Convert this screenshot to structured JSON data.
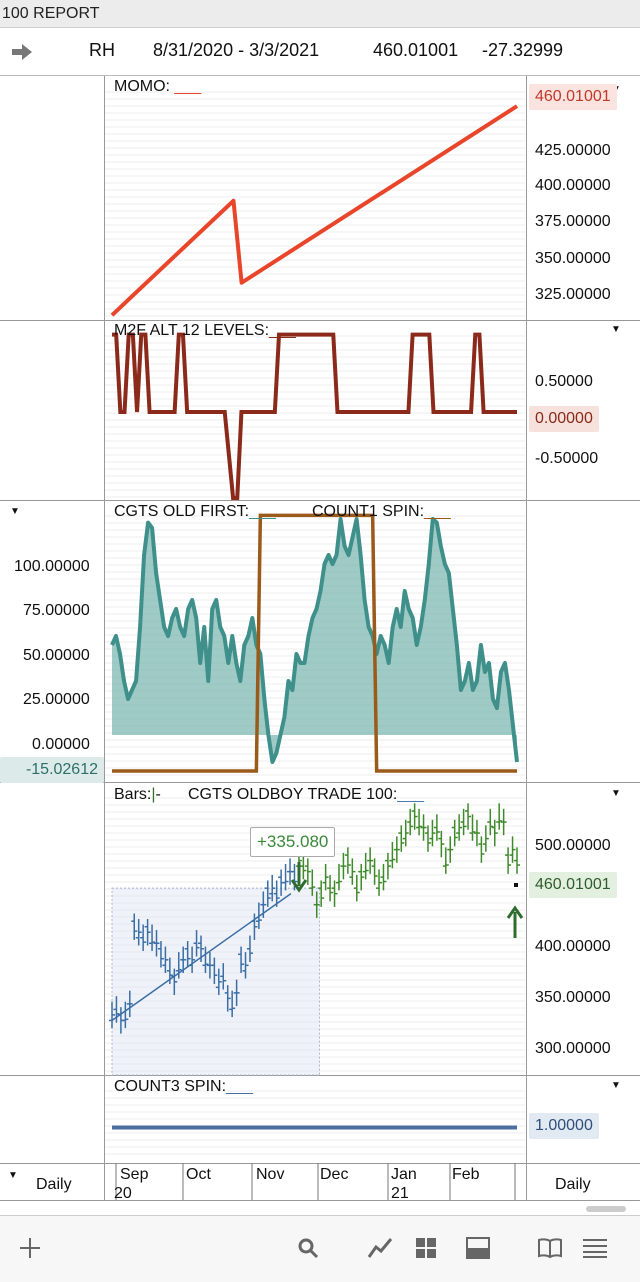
{
  "window": {
    "title": "100  REPORT"
  },
  "header": {
    "symbol": "RH",
    "date_range": "8/31/2020 - 3/3/2021",
    "last_price": "460.01001",
    "change": "-27.32999"
  },
  "panes": {
    "momo": {
      "title": "MOMO:",
      "value_badge": "460.01001",
      "ticks": [
        "425.00000",
        "400.00000",
        "375.00000",
        "350.00000",
        "325.00000"
      ]
    },
    "m2f": {
      "title": "M2F ALT 12 LEVELS:",
      "value_badge": "0.00000",
      "ticks": [
        "0.50000",
        "-0.50000"
      ]
    },
    "cgts": {
      "title1": "CGTS OLD FIRST:",
      "title2": "COUNT1 SPIN:",
      "value_badge": "-15.02612",
      "ticks": [
        "100.00000",
        "75.00000",
        "50.00000",
        "25.00000",
        "0.00000"
      ]
    },
    "bars": {
      "title1": "Bars:",
      "title2": "CGTS OLDBOY TRADE 100:",
      "value_badge": "460.01001",
      "measure_label": "+335.080",
      "ticks": [
        "500.00000",
        "400.00000",
        "350.00000",
        "300.00000"
      ]
    },
    "count3": {
      "title": "COUNT3 SPIN:",
      "value_badge": "1.00000"
    }
  },
  "time_axis": {
    "left_period": "Daily",
    "right_period": "Daily",
    "months": [
      "Sep",
      "Oct",
      "Nov",
      "Dec",
      "Jan",
      "Feb"
    ],
    "years": [
      "20",
      "21"
    ]
  },
  "toolbar": {
    "icons": [
      "add-icon",
      "search-icon",
      "draw-trend-icon",
      "layout-grid-icon",
      "panel-icon",
      "book-icon",
      "list-icon"
    ]
  },
  "chart_data": [
    {
      "type": "line",
      "title": "MOMO",
      "ylim": [
        310,
        470
      ],
      "series": [
        {
          "color": "#e8452a",
          "x": [
            0,
            30,
            32,
            100
          ],
          "values": [
            312,
            393,
            335,
            460
          ]
        }
      ]
    },
    {
      "type": "line",
      "title": "M2F ALT 12 LEVELS",
      "ylim": [
        -1.0,
        1.0
      ],
      "series": [
        {
          "color": "#8b2a1a",
          "values": [
            0.9,
            0.9,
            0,
            0,
            0.9,
            0.9,
            0,
            0.9,
            0.9,
            0,
            0,
            0,
            0,
            0,
            0,
            0,
            0.9,
            0.9,
            0,
            0,
            0,
            0,
            0,
            0,
            0,
            0,
            0,
            0,
            -0.5,
            -1.0,
            -1.0,
            0,
            0,
            0,
            0,
            0,
            0,
            0,
            0,
            0,
            0.9,
            0.9,
            0.9,
            0.9,
            0.9,
            0.9,
            0.9,
            0.9,
            0.9,
            0.9,
            0.9,
            0.9,
            0.9,
            0.9,
            0,
            0,
            0,
            0,
            0,
            0,
            0,
            0,
            0,
            0,
            0,
            0,
            0,
            0,
            0,
            0,
            0,
            0,
            0.9,
            0.9,
            0.9,
            0.9,
            0.9,
            0,
            0,
            0,
            0,
            0,
            0,
            0,
            0,
            0,
            0,
            0.9,
            0.9,
            0,
            0,
            0,
            0,
            0,
            0,
            0,
            0,
            0
          ]
        }
      ]
    },
    {
      "type": "area",
      "title": "CGTS OLD FIRST / COUNT1 SPIN",
      "ylim": [
        -25,
        125
      ],
      "series": [
        {
          "name": "CGTS OLD FIRST",
          "color": "#3f8f8a",
          "values": [
            50,
            55,
            45,
            30,
            20,
            25,
            30,
            60,
            100,
            118,
            115,
            90,
            75,
            60,
            55,
            65,
            70,
            60,
            55,
            70,
            75,
            65,
            40,
            60,
            30,
            70,
            75,
            60,
            55,
            40,
            55,
            40,
            30,
            50,
            55,
            65,
            50,
            45,
            20,
            0,
            -15,
            -10,
            0,
            10,
            30,
            25,
            45,
            40,
            40,
            55,
            65,
            70,
            80,
            95,
            100,
            95,
            100,
            120,
            105,
            100,
            110,
            120,
            100,
            75,
            60,
            55,
            45,
            55,
            50,
            40,
            60,
            70,
            60,
            80,
            70,
            65,
            50,
            60,
            75,
            95,
            120,
            118,
            105,
            95,
            90,
            70,
            50,
            25,
            30,
            40,
            25,
            30,
            50,
            35,
            40,
            20,
            15,
            35,
            40,
            25,
            5,
            -15
          ]
        },
        {
          "name": "COUNT1 SPIN",
          "color": "#9a5a1a",
          "values": [
            -20,
            -20,
            -20,
            -20,
            -20,
            -20,
            -20,
            -20,
            -20,
            -20,
            -20,
            -20,
            -20,
            -20,
            -20,
            -20,
            -20,
            -20,
            -20,
            -20,
            -20,
            -20,
            -20,
            -20,
            -20,
            -20,
            -20,
            -20,
            -20,
            -20,
            -20,
            -20,
            -20,
            -20,
            -20,
            -20,
            -20,
            122,
            122,
            122,
            122,
            122,
            122,
            122,
            122,
            122,
            122,
            122,
            122,
            122,
            122,
            122,
            122,
            122,
            122,
            122,
            122,
            122,
            122,
            122,
            122,
            122,
            122,
            122,
            122,
            122,
            -20,
            -20,
            -20,
            -20,
            -20,
            -20,
            -20,
            -20,
            -20,
            -20,
            -20,
            -20,
            -20,
            -20,
            -20,
            -20,
            -20,
            -20,
            -20,
            -20,
            -20,
            -20,
            -20,
            -20,
            -20,
            -20,
            -20,
            -20,
            -20,
            -20,
            -20,
            -20,
            -20,
            -20,
            -20,
            -20
          ]
        }
      ]
    },
    {
      "type": "bar",
      "title": "Bars",
      "ylim": [
        280,
        525
      ],
      "series": [
        {
          "name": "price",
          "values": [
            330,
            335,
            325,
            330,
            340,
            410,
            405,
            400,
            405,
            400,
            395,
            385,
            380,
            370,
            360,
            375,
            380,
            385,
            380,
            395,
            390,
            380,
            375,
            370,
            360,
            365,
            345,
            340,
            350,
            380,
            375,
            390,
            410,
            420,
            430,
            440,
            445,
            440,
            450,
            455,
            460,
            455,
            470,
            465,
            460,
            450,
            430,
            440,
            455,
            445,
            440,
            455,
            465,
            470,
            460,
            445,
            455,
            465,
            470,
            460,
            450,
            455,
            465,
            475,
            480,
            490,
            495,
            505,
            510,
            505,
            500,
            490,
            495,
            500,
            485,
            470,
            480,
            495,
            500,
            505,
            510,
            500,
            495,
            480,
            490,
            505,
            495,
            510,
            505,
            470,
            480,
            470
          ]
        }
      ]
    },
    {
      "type": "line",
      "title": "COUNT3 SPIN",
      "ylim": [
        0,
        2
      ],
      "series": [
        {
          "color": "#4a6fa0",
          "values": [
            1,
            1
          ]
        }
      ]
    }
  ]
}
